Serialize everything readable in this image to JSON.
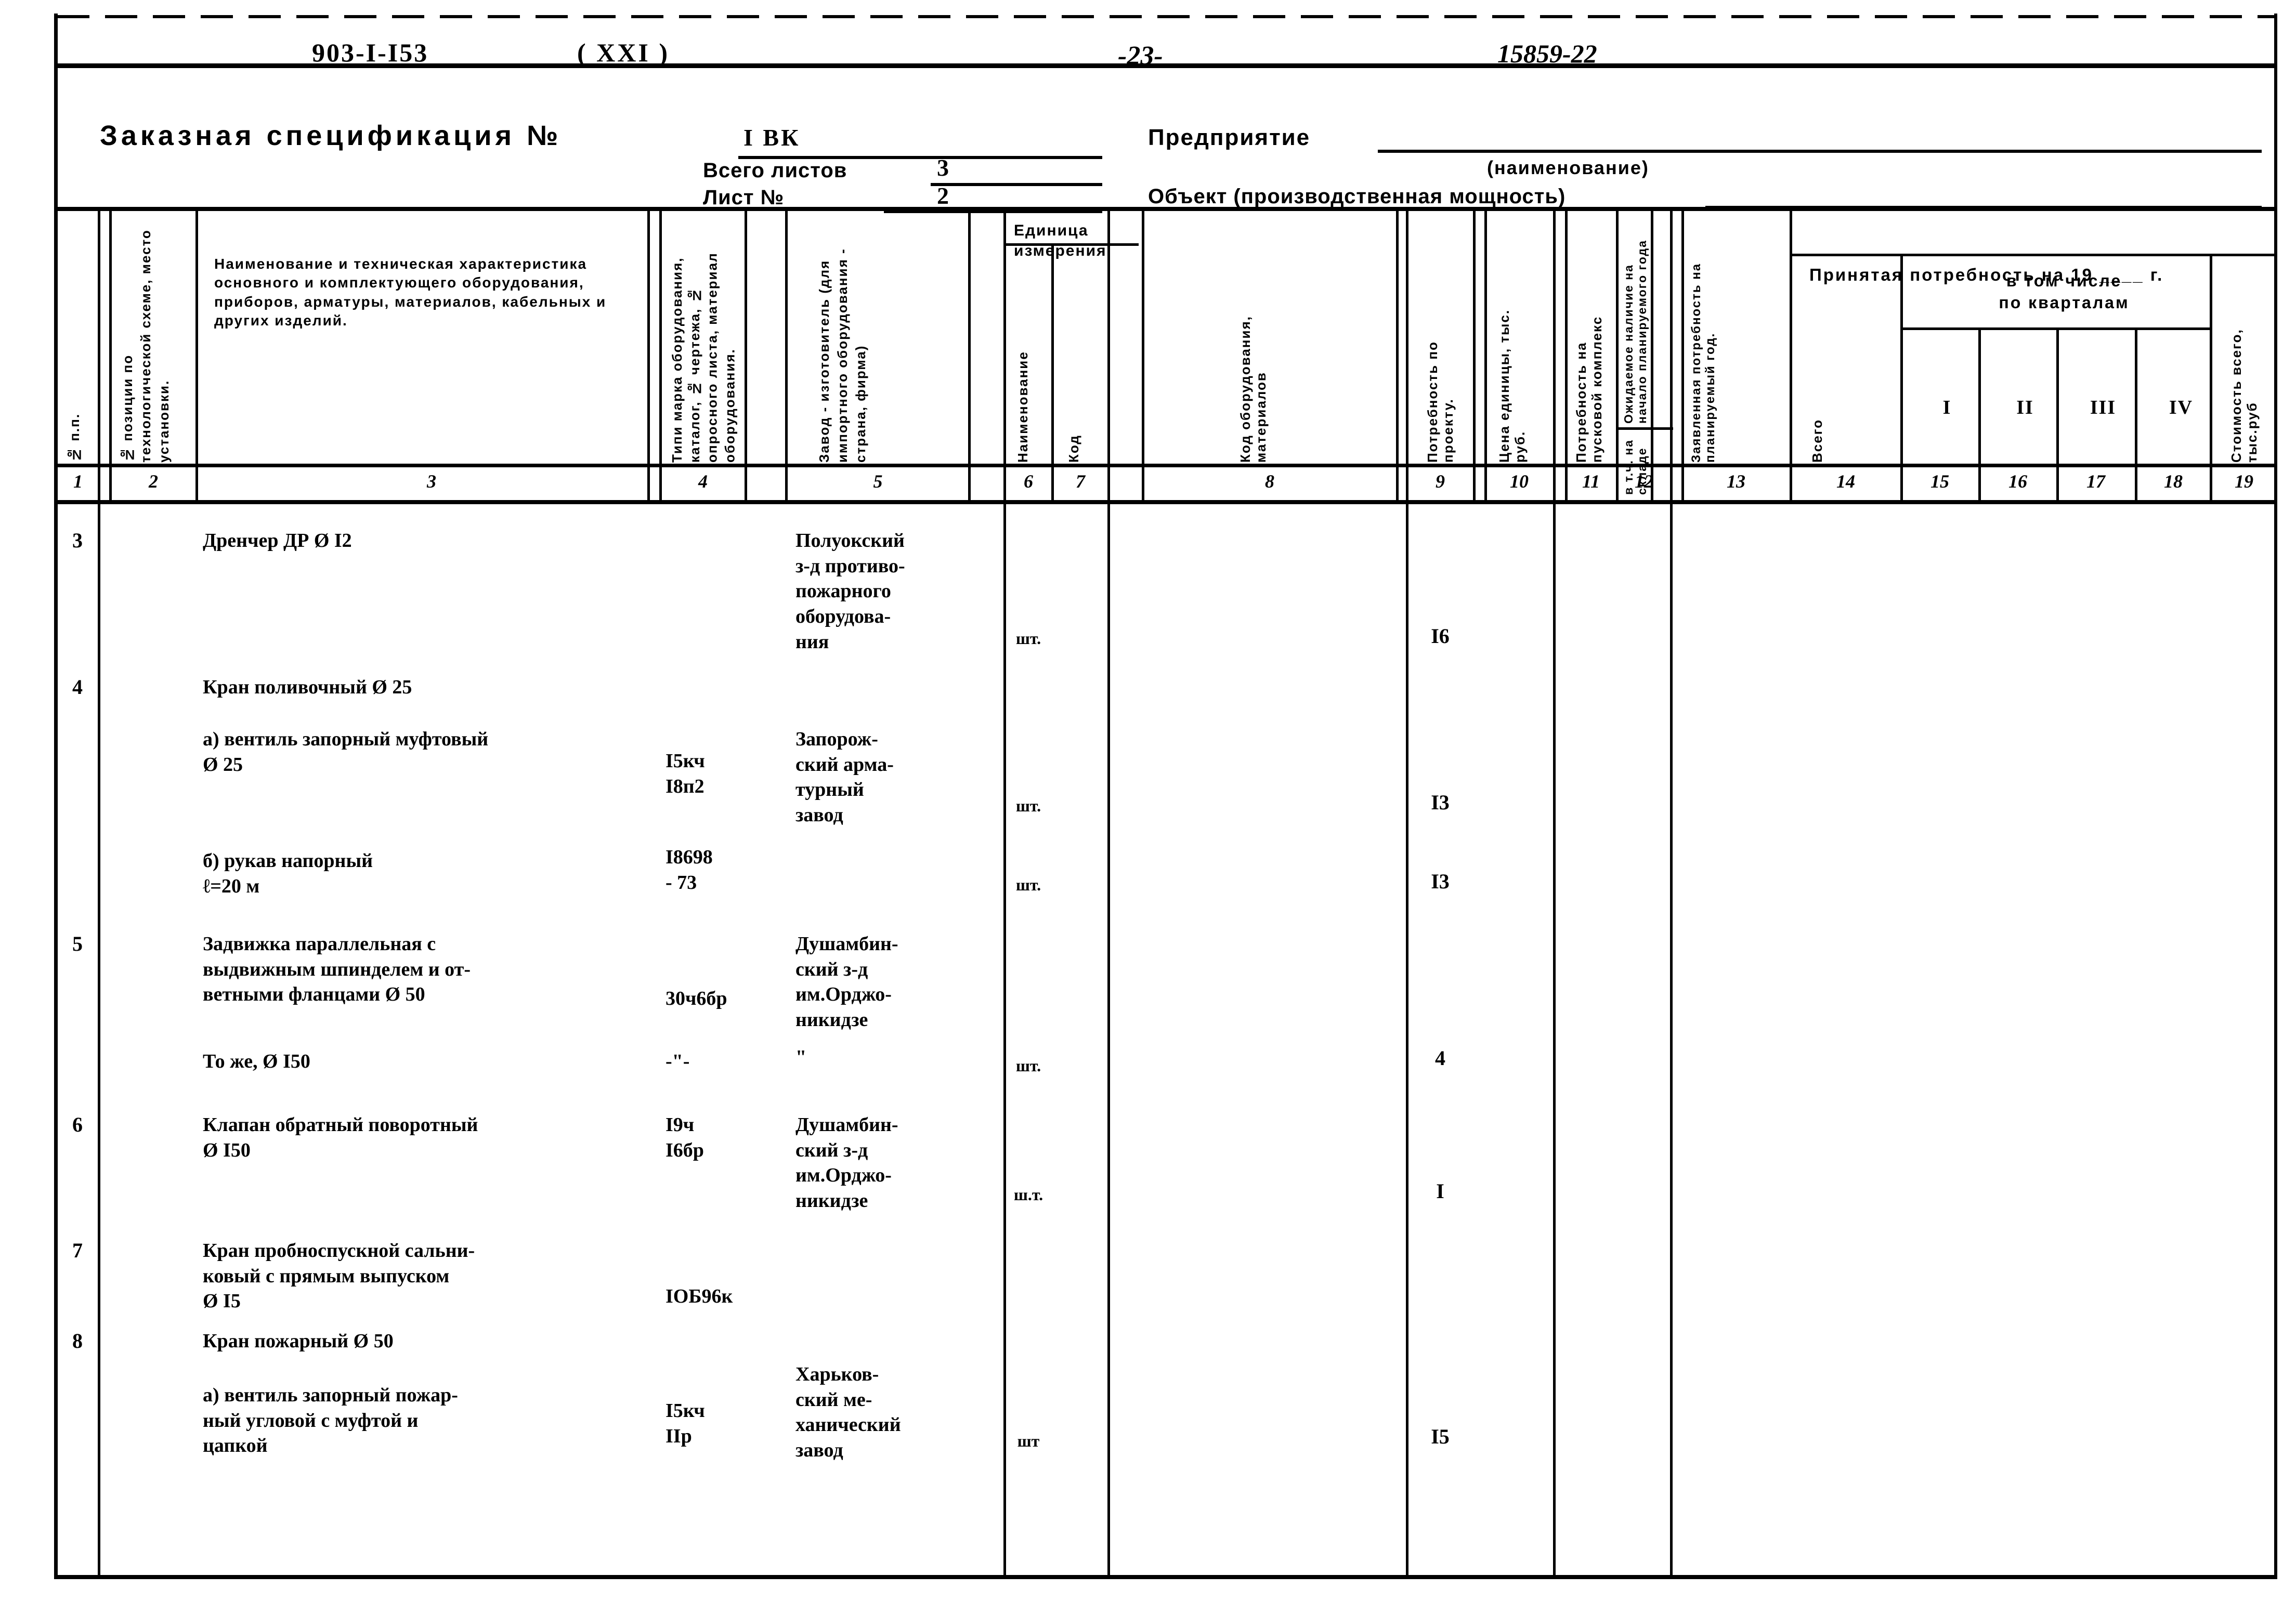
{
  "header": {
    "doc_code": "903-I-I53",
    "series": "( XXI )",
    "page_number": "-23-",
    "archive_number": "15859-22"
  },
  "title_block": {
    "title": "Заказная спецификация №",
    "spec_number": "I ВК",
    "total_sheets_label": "Всего листов",
    "total_sheets_value": "3",
    "sheet_no_label": "Лист №",
    "sheet_no_value": "2",
    "enterprise_label": "Предприятие",
    "naimenovanie_label": "(наименование)",
    "object_label": "Объект (производственная мощность)"
  },
  "table": {
    "columns": [
      {
        "no": "1",
        "title": "№ п.п.",
        "orient": "v"
      },
      {
        "no": "2",
        "title": "№ позиции по технологической схеме, место установки.",
        "orient": "v"
      },
      {
        "no": "3",
        "title": "Наименование и техническая характеристика основного и комплектующего оборудования, приборов, арматуры, материалов, кабельных и других изделий.",
        "orient": "h"
      },
      {
        "no": "4",
        "title": "Типи марка оборудования, каталог, № чертежа, № опросного листа, материал оборудования.",
        "orient": "v"
      },
      {
        "no": "5",
        "title": "Завод - изготовитель (для импортного оборудования - страна, фирма)",
        "orient": "v"
      },
      {
        "no": "6",
        "title": "Наименование",
        "orient": "v"
      },
      {
        "no": "7",
        "title": "Код",
        "orient": "v"
      },
      {
        "no": "8",
        "title": "Код оборудования, материалов",
        "orient": "v"
      },
      {
        "no": "9",
        "title": "Потребность по проекту.",
        "orient": "v"
      },
      {
        "no": "10",
        "title": "Цена единицы, тыс. руб.",
        "orient": "v"
      },
      {
        "no": "11",
        "title": "Потребность на пусковой комплекс",
        "orient": "v"
      },
      {
        "no": "12",
        "title": "Ожидаемое наличие на начало планируемого года",
        "sub": "в т.ч. на складе",
        "orient": "v"
      },
      {
        "no": "13",
        "title": "Заявленная потребность на планируемый год.",
        "orient": "v"
      },
      {
        "no": "14",
        "title": "Всего",
        "orient": "v"
      },
      {
        "no": "15",
        "title": "I",
        "orient": "h"
      },
      {
        "no": "16",
        "title": "II",
        "orient": "h"
      },
      {
        "no": "17",
        "title": "III",
        "orient": "h"
      },
      {
        "no": "18",
        "title": "IV",
        "orient": "h"
      },
      {
        "no": "19",
        "title": "Стоимость всего, тыс.руб",
        "orient": "v"
      }
    ],
    "group_headers": {
      "units": "Единица\nизмерения",
      "accepted_need": "Принятая  потребность на 19 ____ г.",
      "quarters": "в том  числе\nпо  кварталам"
    },
    "rows": [
      {
        "no": "3",
        "name": "Дренчер  ДР Ø I2",
        "type_mark": "",
        "manufacturer": "Полуокский\nз-д противо-\nпожарного\nоборудова-\nния",
        "unit": "шт.",
        "qty": "I6"
      },
      {
        "no": "4",
        "name": "Кран поливочный Ø 25",
        "type_mark": "",
        "manufacturer": "",
        "unit": "",
        "qty": ""
      },
      {
        "no": "",
        "name": "а) вентиль запорный муфтовый\n          Ø 25",
        "type_mark": "I5кч\nI8п2",
        "manufacturer": "Запорож-\nский арма-\nтурный\nзавод",
        "unit": "шт.",
        "qty": "I3"
      },
      {
        "no": "",
        "name": "б) рукав напорный\n         ℓ=20 м",
        "type_mark": "I8698\n- 73",
        "manufacturer": "",
        "unit": "шт.",
        "qty": "I3"
      },
      {
        "no": "5",
        "name": "Задвижка параллельная с\nвыдвижным шпинделем и от-\nветными фланцами Ø 50",
        "type_mark": "30ч6бр",
        "manufacturer": "Душамбин-\nский з-д\nим.Орджо-\nникидзе",
        "unit": "",
        "qty": ""
      },
      {
        "no": "",
        "name": "То же, Ø I50",
        "type_mark": "-\"-",
        "manufacturer": "\"",
        "unit": "шт.",
        "qty": "4"
      },
      {
        "no": "6",
        "name": "Клапан обратный поворотный\n           Ø I50",
        "type_mark": "I9ч\nI6бр",
        "manufacturer": "Душамбин-\nский з-д\nим.Орджо-\nникидзе",
        "unit": "ш.т.",
        "qty": "I"
      },
      {
        "no": "7",
        "name": "Кран пробноспускной сальни-\nковый с прямым выпуском\n            Ø I5",
        "type_mark": "IОБ96к",
        "manufacturer": "",
        "unit": "",
        "qty": ""
      },
      {
        "no": "8",
        "name": "Кран пожарный Ø 50",
        "type_mark": "",
        "manufacturer": "",
        "unit": "",
        "qty": ""
      },
      {
        "no": "",
        "name": "а) вентиль запорный пожар-\n   ный угловой с муфтой и\n   цапкой",
        "type_mark": "I5кч\nIIp",
        "manufacturer": "Харьков-\nский ме-\nханический\nзавод",
        "unit": "шт",
        "qty": "I5"
      }
    ]
  }
}
